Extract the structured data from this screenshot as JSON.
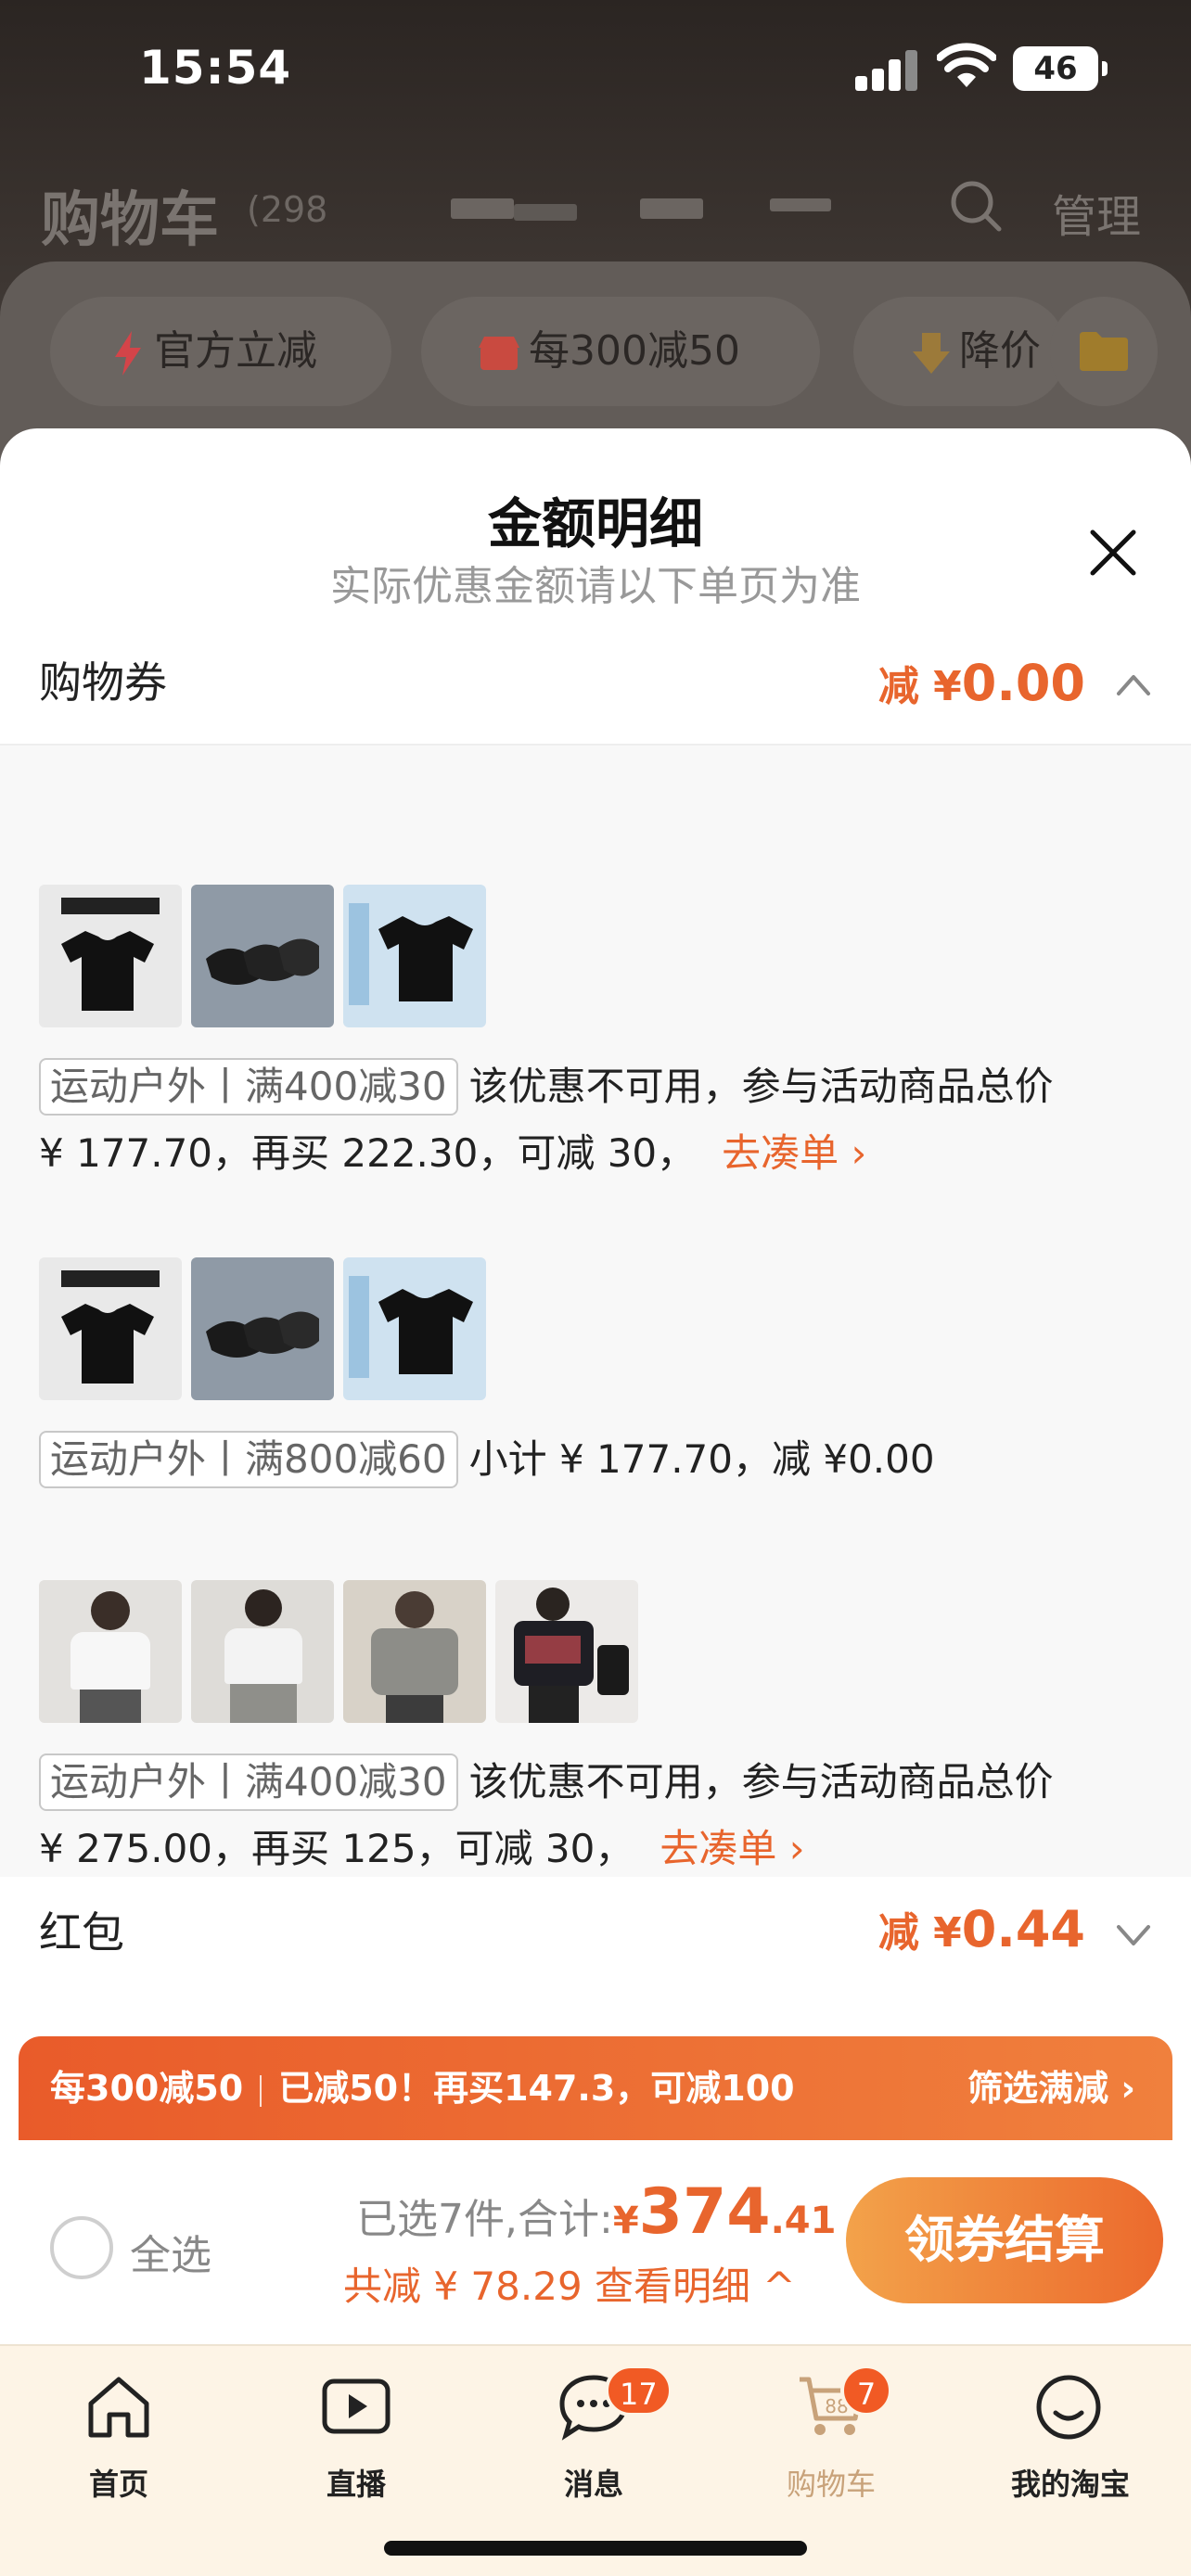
{
  "status_bar": {
    "time": "15:54",
    "battery": "46"
  },
  "header": {
    "title": "购物车",
    "count": "(298",
    "manage_label": "管理"
  },
  "filters": [
    {
      "label": "官方立减",
      "icon": "lightning-icon"
    },
    {
      "label": "每300减50",
      "icon": "shop-icon"
    },
    {
      "label": "降价",
      "icon": "down-arrow-icon"
    }
  ],
  "sheet": {
    "title": "金额明细",
    "subtitle": "实际优惠金额请以下单页为准",
    "coupons_row": {
      "label": "购物券",
      "prefix": "减 ¥",
      "amount": "0.00"
    },
    "groups": [
      {
        "tag": "运动户外丨满400减30",
        "text1": "该优惠不可用，参与活动商品总价",
        "text2": "¥ 177.70，再买 222.30，可减 30，",
        "link": "去凑单 ›"
      },
      {
        "tag": "运动户外丨满800减60",
        "text1": "小计 ¥ 177.70，减 ¥0.00"
      },
      {
        "tag": "运动户外丨满400减30",
        "text1": "该优惠不可用，参与活动商品总价",
        "text2": "¥ 275.00，再买 125，可减 30，",
        "link": "去凑单 ›"
      }
    ],
    "redpacket_row": {
      "label": "红包",
      "prefix": "减 ¥",
      "amount": "0.44"
    }
  },
  "promo_banner": {
    "part1": "每300减50",
    "part2": "已减50！再买147.3，可减100",
    "action": "筛选满减 ›"
  },
  "checkout": {
    "select_all": "全选",
    "selected_text": "已选7件,合计:",
    "currency": "¥",
    "total_int": "374",
    "total_dec": ".41",
    "saved_text": "共减 ¥ 78.29 查看明细 ^",
    "button": "领券结算"
  },
  "tabs": [
    {
      "label": "首页",
      "icon": "home-icon"
    },
    {
      "label": "直播",
      "icon": "live-play-icon"
    },
    {
      "label": "消息",
      "icon": "message-bubble-icon",
      "badge": "17"
    },
    {
      "label": "购物车",
      "icon": "cart-icon",
      "badge": "7"
    },
    {
      "label": "我的淘宝",
      "icon": "smile-face-icon"
    }
  ],
  "colors": {
    "accent": "#e8652d",
    "brand_orange": "#f15a24"
  }
}
